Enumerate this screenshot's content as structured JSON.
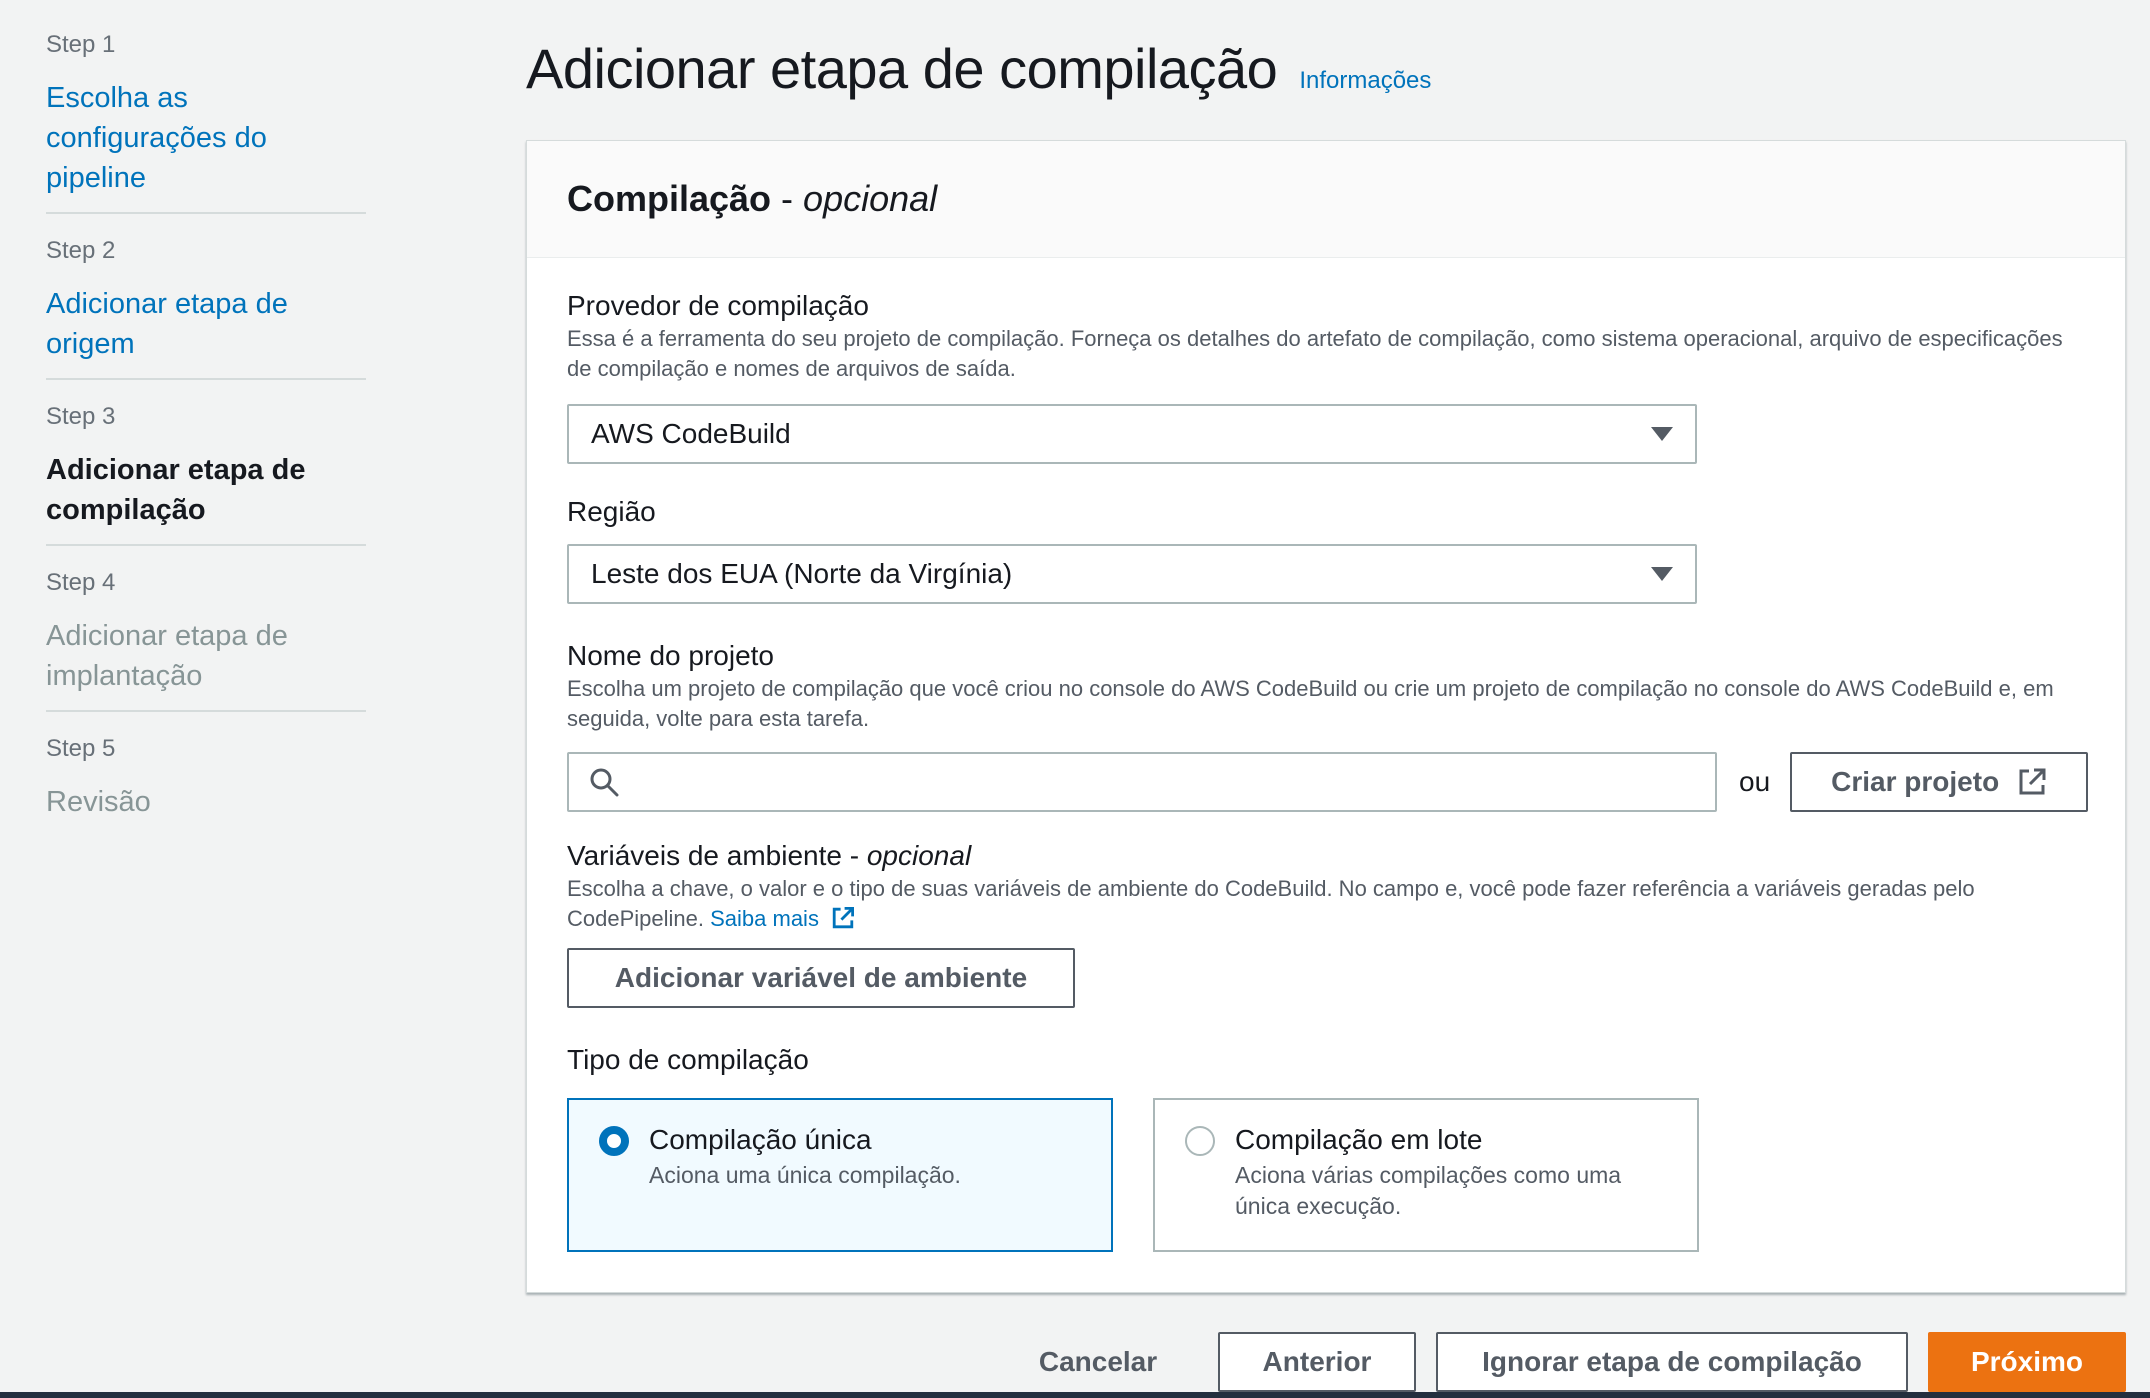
{
  "sidebar": {
    "steps": [
      {
        "num": "Step 1",
        "label": "Escolha as configurações do pipeline",
        "state": "link"
      },
      {
        "num": "Step 2",
        "label": "Adicionar etapa de origem",
        "state": "link"
      },
      {
        "num": "Step 3",
        "label": "Adicionar etapa de compilação",
        "state": "current"
      },
      {
        "num": "Step 4",
        "label": "Adicionar etapa de implantação",
        "state": "disabled"
      },
      {
        "num": "Step 5",
        "label": "Revisão",
        "state": "disabled"
      }
    ]
  },
  "header": {
    "title": "Adicionar etapa de compilação",
    "info_link": "Informações"
  },
  "panel": {
    "title": "Compilação",
    "title_sep": " - ",
    "title_suffix": "opcional",
    "provider": {
      "label": "Provedor de compilação",
      "desc": "Essa é a ferramenta do seu projeto de compilação. Forneça os detalhes do artefato de compilação, como sistema operacional, arquivo de especificações de compilação e nomes de arquivos de saída.",
      "value": "AWS CodeBuild"
    },
    "region": {
      "label": "Região",
      "value": "Leste dos EUA (Norte da Virgínia)"
    },
    "project": {
      "label": "Nome do projeto",
      "desc": "Escolha um projeto de compilação que você criou no console do AWS CodeBuild ou crie um projeto de compilação no console do AWS CodeBuild e, em seguida, volte para esta tarefa.",
      "search_value": "",
      "or_text": "ou",
      "create_label": "Criar projeto"
    },
    "env": {
      "label": "Variáveis de ambiente",
      "label_sep": " - ",
      "label_suffix": "opcional",
      "desc": "Escolha a chave, o valor e o tipo de suas variáveis de ambiente do CodeBuild. No campo e, você pode fazer referência a variáveis geradas pelo CodePipeline.",
      "learn_more": "Saiba mais",
      "add_button": "Adicionar variável de ambiente"
    },
    "build_type": {
      "label": "Tipo de compilação",
      "options": [
        {
          "title": "Compilação única",
          "desc": "Aciona uma única compilação.",
          "selected": true
        },
        {
          "title": "Compilação em lote",
          "desc": "Aciona várias compilações como uma única execução.",
          "selected": false
        }
      ]
    }
  },
  "footer": {
    "cancel": "Cancelar",
    "previous": "Anterior",
    "skip": "Ignorar etapa de compilação",
    "next": "Próximo"
  },
  "colors": {
    "link": "#0073bb",
    "primary": "#ec7211",
    "background": "#f2f3f3"
  },
  "icons": {
    "select_caret": "caret-down-icon",
    "search": "search-icon",
    "external": "external-link-icon"
  }
}
